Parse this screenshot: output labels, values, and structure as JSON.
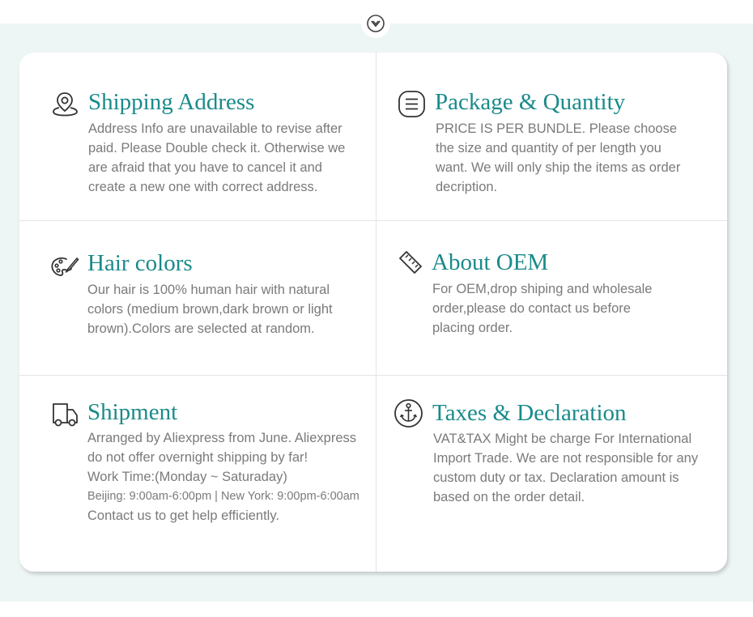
{
  "colors": {
    "accent": "#1b8a8a",
    "body_text": "#7a7a7a",
    "band": "#eef5f5",
    "icon": "#333333"
  },
  "header": {
    "toggle_icon": "chevron-down-icon"
  },
  "sections": {
    "shipping_address": {
      "icon": "location-pin-icon",
      "title": "Shipping Address",
      "lines": [
        "Address Info are unavailable to revise after",
        "paid. Please Double check it. Otherwise we",
        "are afraid that you have to cancel it and",
        "create a new one with correct address."
      ]
    },
    "package_quantity": {
      "icon": "list-icon",
      "title": "Package & Quantity",
      "lines": [
        "PRICE IS PER BUNDLE. Please choose",
        "the size and quantity of per length you",
        "want. We will only ship the items as order",
        "decription."
      ]
    },
    "hair_colors": {
      "icon": "palette-icon",
      "title": "Hair colors",
      "lines": [
        "Our hair is 100% human hair with natural",
        "colors (medium brown,dark brown or light",
        "brown).Colors are selected at random."
      ]
    },
    "about_oem": {
      "icon": "ruler-icon",
      "title": "About OEM",
      "lines": [
        "For OEM,drop shiping and wholesale",
        "order,please do contact us before",
        "placing order."
      ]
    },
    "shipment": {
      "icon": "truck-icon",
      "title": "Shipment",
      "lines": [
        "Arranged by Aliexpress from June. Aliexpress",
        "do not offer overnight shipping by far!",
        "Work Time:(Monday ~ Saturaday)",
        "Beijing: 9:00am-6:00pm | New York: 9:00pm-6:00am",
        "Contact us to get help efficiently."
      ]
    },
    "taxes_declaration": {
      "icon": "anchor-icon",
      "title": "Taxes & Declaration",
      "lines": [
        "VAT&TAX Might be charge For International",
        "Import Trade. We are not responsible for any",
        "custom duty or tax. Declaration amount is",
        "based on the order detail."
      ]
    }
  }
}
